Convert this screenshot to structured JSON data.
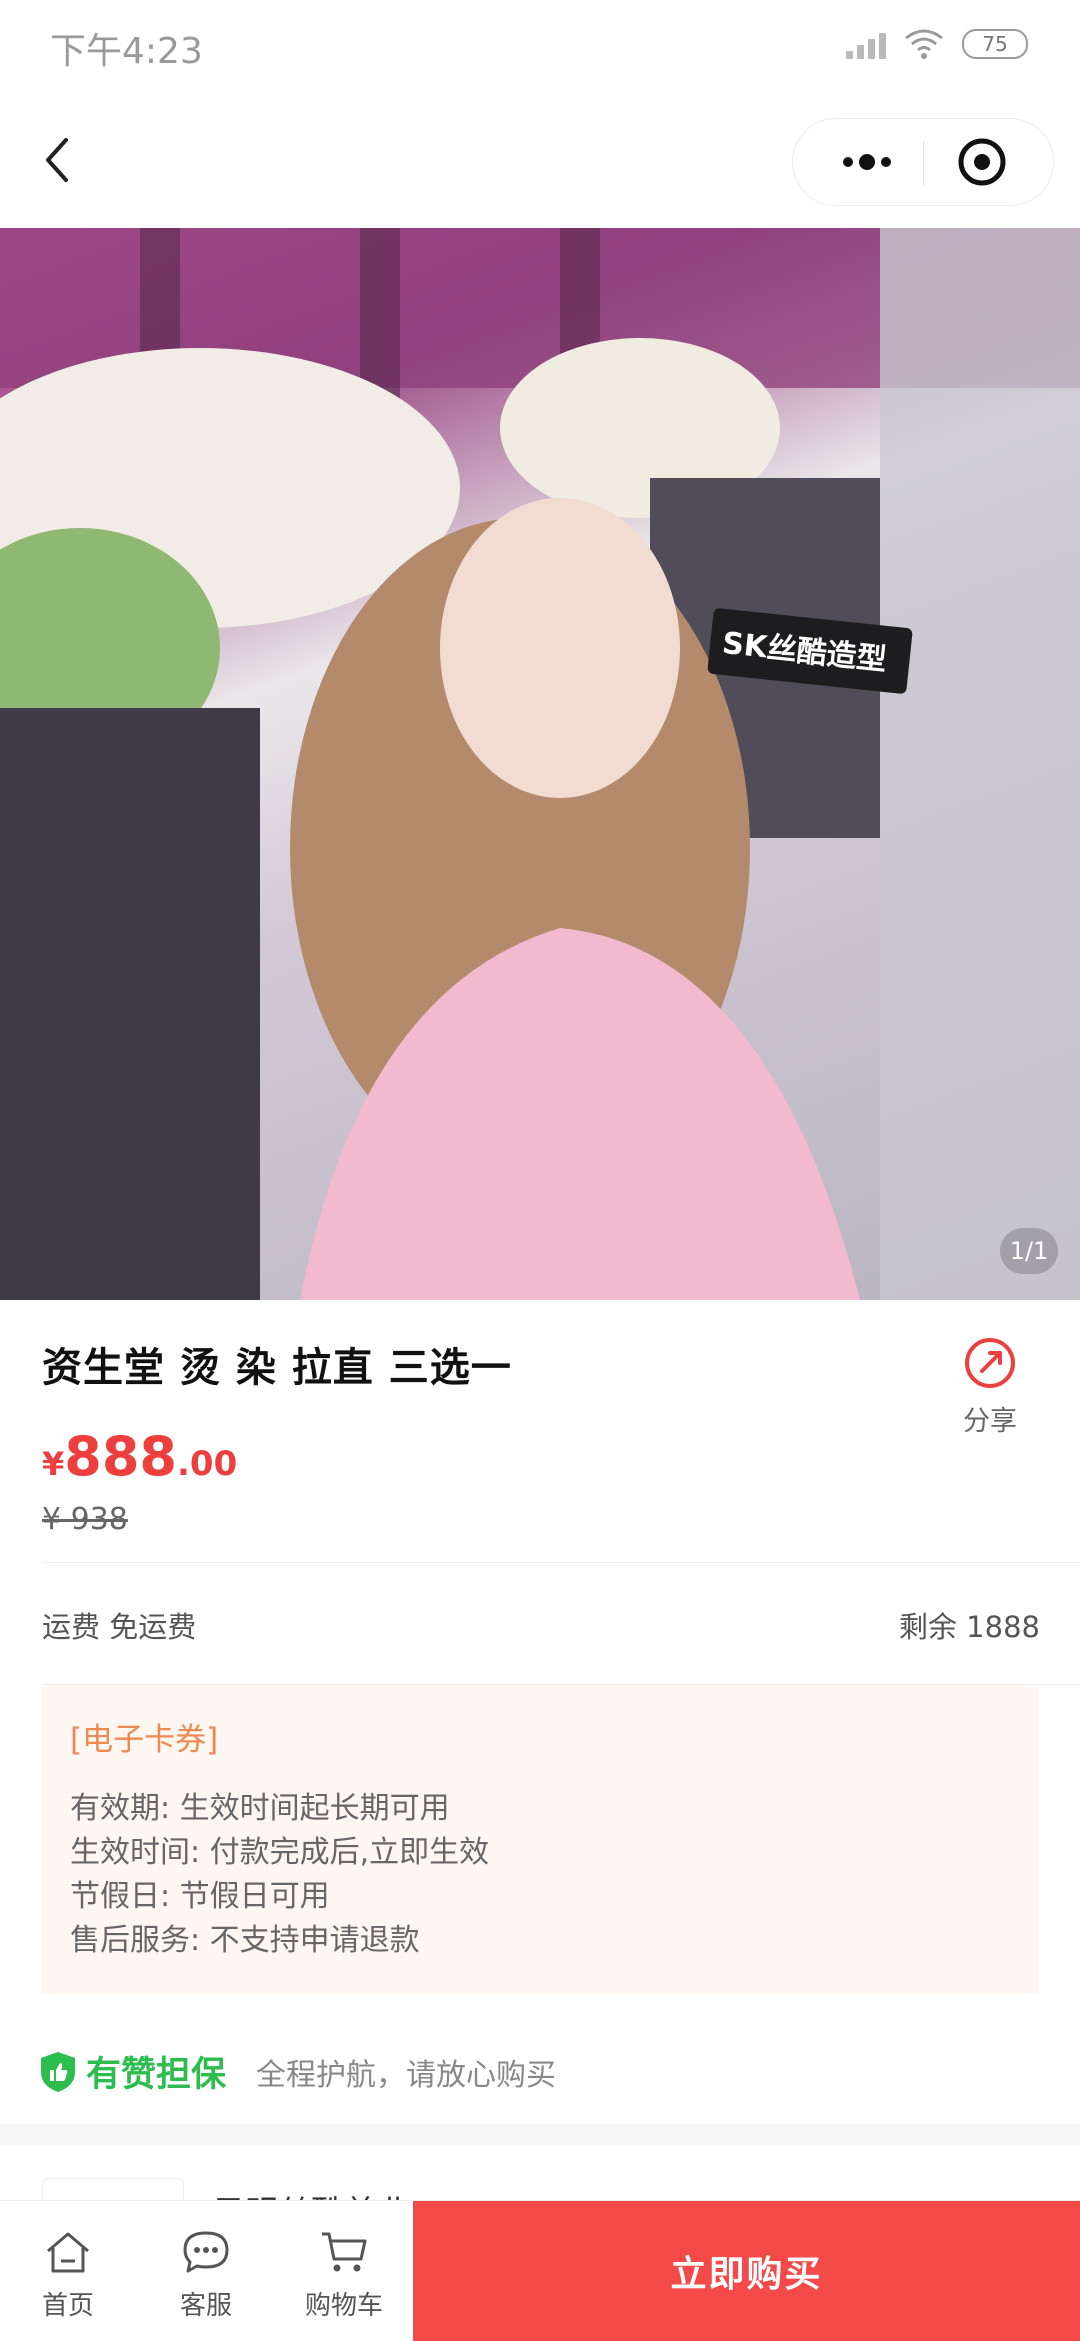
{
  "status_bar": {
    "time": "下午4:23",
    "battery": "75"
  },
  "product": {
    "title": "资生堂 烫 染 拉直 三选一",
    "share_label": "分享",
    "price_currency": "¥",
    "price_int": "888",
    "price_dec": ".00",
    "original_price": "¥ 938",
    "image_counter": "1/1",
    "image_sign_text": "SK丝酷造型"
  },
  "shipping": {
    "label": "运费 免运费",
    "stock": "剩余 1888"
  },
  "ecard": {
    "tag": "[电子卡券]",
    "lines": [
      "有效期: 生效时间起长期可用",
      "生效时间: 付款完成后,立即生效",
      "节假日: 节假日可用",
      "售后服务: 不支持申请退款"
    ]
  },
  "guarantee": {
    "name": "有赞担保",
    "desc": "全程护航，请放心购买"
  },
  "shop": {
    "name": "目明丝酷美业"
  },
  "tabbar": {
    "home": "首页",
    "service": "客服",
    "cart": "购物车",
    "buy": "立即购买"
  },
  "colors": {
    "accent": "#f44949",
    "price": "#ee3f3f",
    "guarantee": "#2dbd4e",
    "tag": "#ee8a4f"
  }
}
